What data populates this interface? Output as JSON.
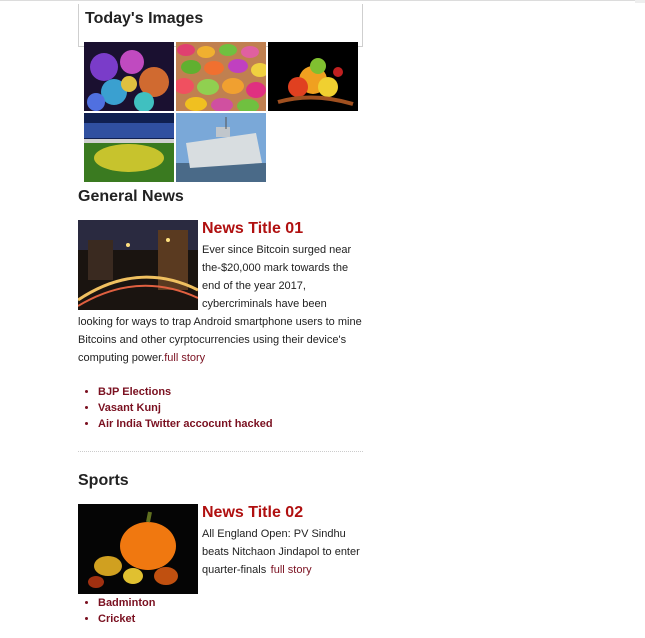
{
  "todays_images": {
    "title": "Today's Images",
    "images": [
      {
        "name": "flowers-image"
      },
      {
        "name": "candies-image"
      },
      {
        "name": "fruits-image"
      },
      {
        "name": "stadium-image"
      },
      {
        "name": "ship-image"
      }
    ]
  },
  "general_news": {
    "heading": "General News",
    "article": {
      "title": "News Title 01",
      "text": "Ever since Bitcoin surged near the-$20,000 mark towards the end of the year 2017, cybercriminals have been looking for ways to trap Android smartphone users to mine Bitcoins and other cyrptocurrencies using their device's computing power.",
      "link": "full story"
    },
    "links": [
      "BJP Elections",
      "Vasant Kunj",
      "Air India Twitter accocunt hacked"
    ]
  },
  "sports": {
    "heading": "Sports",
    "article": {
      "title": "News Title 02",
      "text": "All England Open: PV Sindhu beats Nitchaon Jindapol to enter quarter-finals",
      "link": "full story"
    },
    "links": [
      "Badminton",
      "Cricket"
    ]
  }
}
